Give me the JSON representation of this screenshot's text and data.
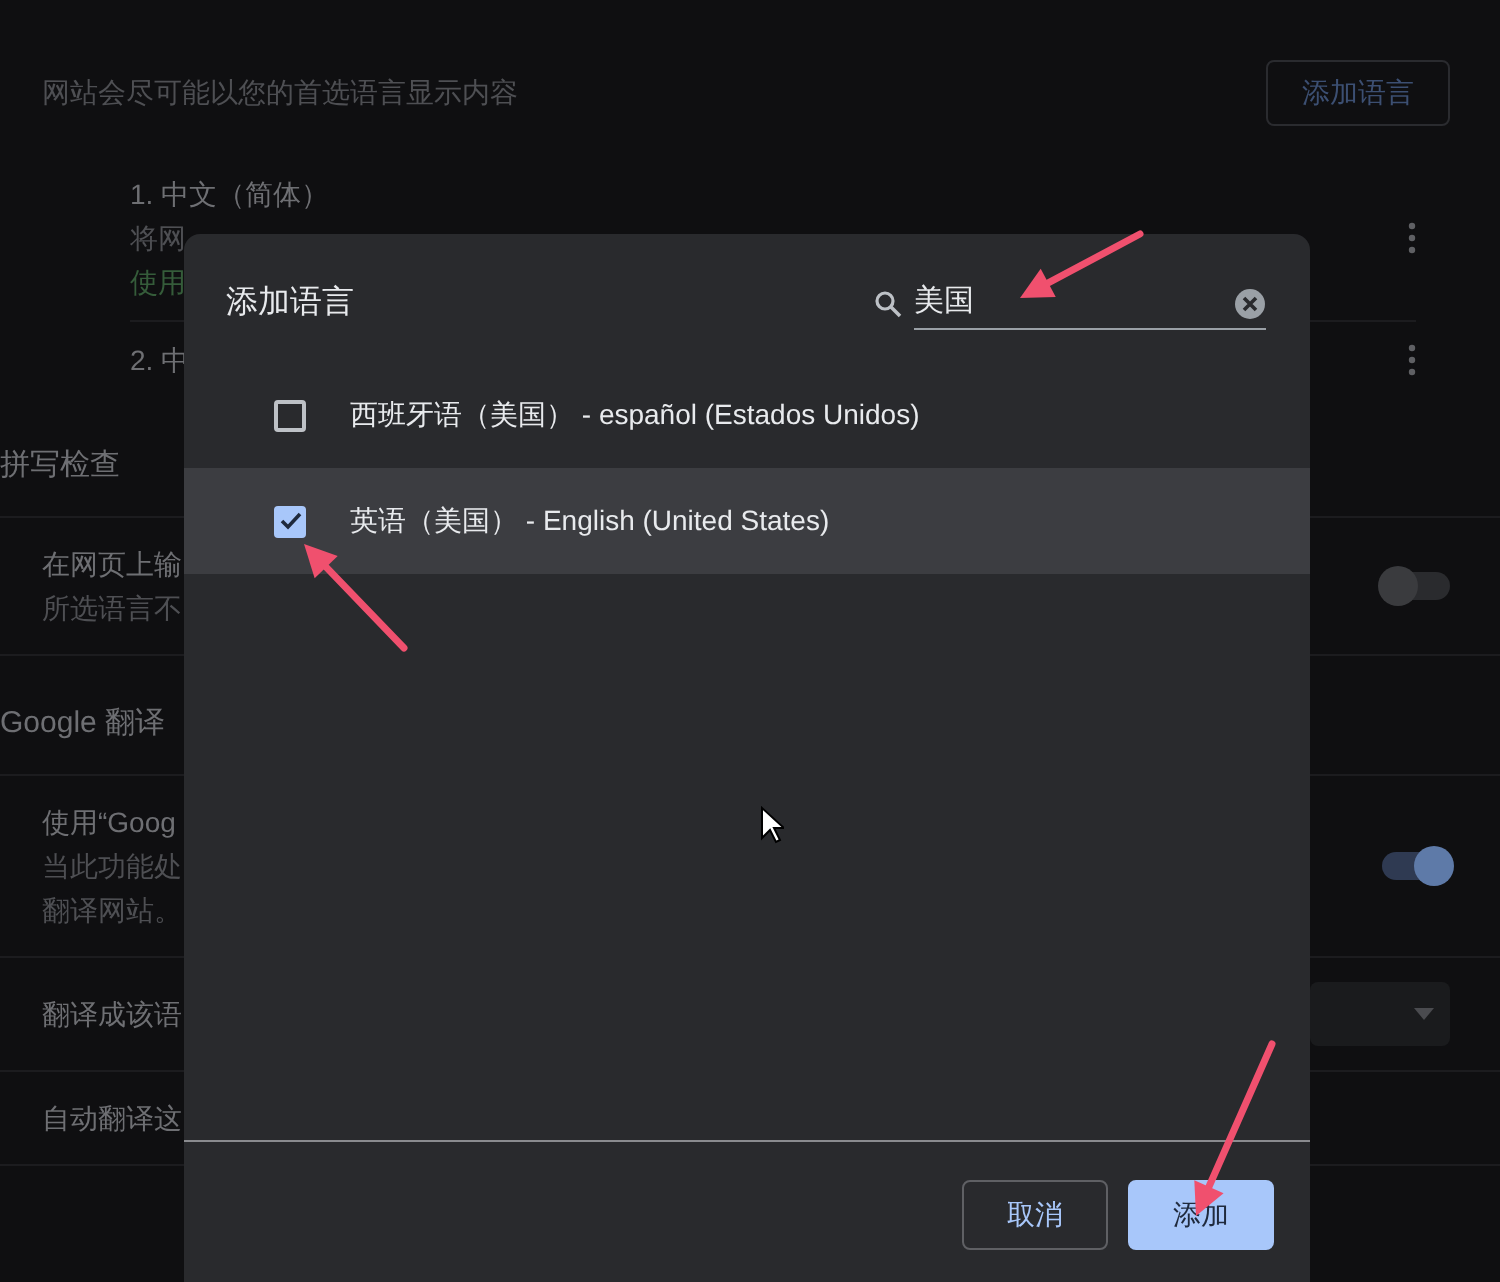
{
  "background": {
    "description": "网站会尽可能以您的首选语言显示内容",
    "add_button": "添加语言",
    "languages": [
      {
        "name": "1. 中文（简体）",
        "lines": [
          {
            "text": "将网",
            "kind": "secondary"
          },
          {
            "text": "使用",
            "kind": "status"
          }
        ]
      },
      {
        "name": "2. 中"
      }
    ],
    "sections": [
      {
        "title": "拼写检查",
        "settings": [
          {
            "label": "在网页上输",
            "description_lines": [
              "所选语言不"
            ],
            "kind": "toggle",
            "on": false
          }
        ]
      },
      {
        "title": "Google 翻译",
        "settings": [
          {
            "label": "使用“Goog",
            "description_lines": [
              "当此功能处",
              "翻译网站。"
            ],
            "kind": "toggle",
            "on": true
          },
          {
            "label": "翻译成该语",
            "kind": "dropdown"
          },
          {
            "label": "自动翻译这",
            "kind": "plain"
          }
        ]
      }
    ]
  },
  "dialog": {
    "title": "添加语言",
    "search": {
      "value": "美国"
    },
    "options": [
      {
        "label": "西班牙语（美国） - español (Estados Unidos)",
        "checked": false,
        "selected": false
      },
      {
        "label": "英语（美国） - English (United States)",
        "checked": true,
        "selected": true
      }
    ],
    "buttons": [
      {
        "label": "取消",
        "kind": "secondary"
      },
      {
        "label": "添加",
        "kind": "primary"
      }
    ]
  }
}
